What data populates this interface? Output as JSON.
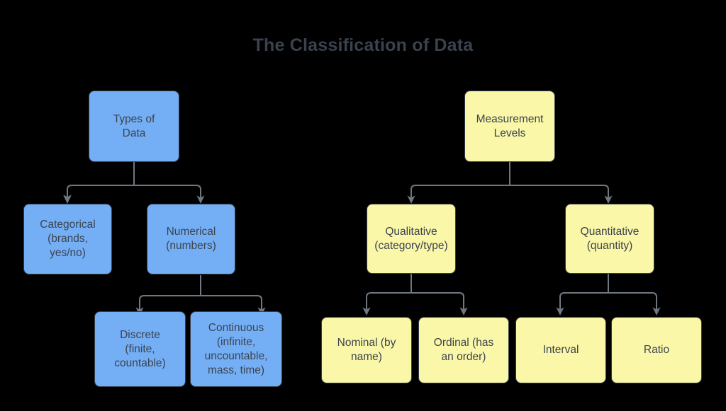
{
  "page": {
    "title": "The Classification of Data",
    "background_color": "#000000",
    "title_color": "#3a424e",
    "connector_color": "#6e7782",
    "node_text_color": "#3b444f",
    "node_border_color": "#36404a"
  },
  "chart_data": {
    "type": "diagram",
    "subtype": "tree-hierarchy",
    "title": "The Classification of Data",
    "trees": [
      {
        "id": "types-of-data",
        "color": "#74aef5",
        "root": "Types of Data",
        "levels": [
          [
            "Types of Data"
          ],
          [
            "Categorical (brands, yes/no)",
            "Numerical (numbers)"
          ],
          [
            "Discrete (finite, countable)",
            "Continuous (infinite, uncountable, mass, time)"
          ]
        ]
      },
      {
        "id": "measurement-levels",
        "color": "#fbf7a8",
        "root": "Measurement Levels",
        "levels": [
          [
            "Measurement Levels"
          ],
          [
            "Qualitative (category/type)",
            "Quantitative (quantity)"
          ],
          [
            "Nominal (by name)",
            "Ordinal (has an order)",
            "Interval",
            "Ratio"
          ]
        ]
      }
    ],
    "edges": [
      {
        "from": "Types of Data",
        "to": "Categorical (brands, yes/no)"
      },
      {
        "from": "Types of Data",
        "to": "Numerical (numbers)"
      },
      {
        "from": "Numerical (numbers)",
        "to": "Discrete (finite, countable)"
      },
      {
        "from": "Numerical (numbers)",
        "to": "Continuous (infinite, uncountable, mass, time)"
      },
      {
        "from": "Measurement Levels",
        "to": "Qualitative (category/type)"
      },
      {
        "from": "Measurement Levels",
        "to": "Quantitative (quantity)"
      },
      {
        "from": "Qualitative (category/type)",
        "to": "Nominal (by name)"
      },
      {
        "from": "Qualitative (category/type)",
        "to": "Ordinal (has an order)"
      },
      {
        "from": "Quantitative (quantity)",
        "to": "Interval"
      },
      {
        "from": "Quantitative (quantity)",
        "to": "Ratio"
      }
    ]
  },
  "left_tree": {
    "root": {
      "line1": "Types of",
      "line2": "Data"
    },
    "categorical": {
      "line1": "Categorical",
      "line2": "(brands,",
      "line3": "yes/no)"
    },
    "numerical": {
      "line1": "Numerical",
      "line2": "(numbers)"
    },
    "discrete": {
      "line1": "Discrete",
      "line2": "(finite,",
      "line3": "countable)"
    },
    "continuous": {
      "line1": "Continuous",
      "line2": "(infinite,",
      "line3": "uncountable,",
      "line4": "mass, time)"
    }
  },
  "right_tree": {
    "root": {
      "line1": "Measurement",
      "line2": "Levels"
    },
    "qualitative": {
      "line1": "Qualitative",
      "line2": "(category/type)"
    },
    "quantitative": {
      "line1": "Quantitative",
      "line2": "(quantity)"
    },
    "nominal": {
      "line1": "Nominal (by",
      "line2": "name)"
    },
    "ordinal": {
      "line1": "Ordinal (has",
      "line2": "an order)"
    },
    "interval": {
      "line1": "Interval"
    },
    "ratio": {
      "line1": "Ratio"
    }
  }
}
